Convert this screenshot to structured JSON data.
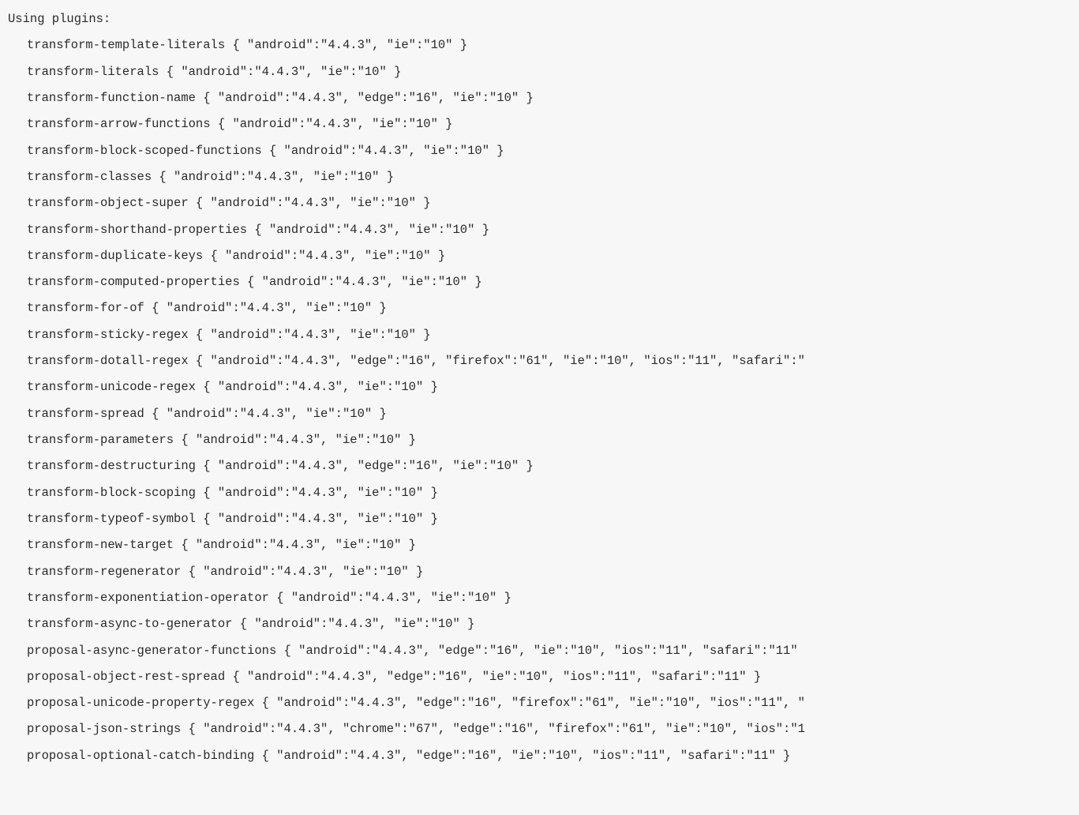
{
  "header": "Using plugins:",
  "lines": [
    "transform-template-literals { \"android\":\"4.4.3\", \"ie\":\"10\" }",
    "transform-literals { \"android\":\"4.4.3\", \"ie\":\"10\" }",
    "transform-function-name { \"android\":\"4.4.3\", \"edge\":\"16\", \"ie\":\"10\" }",
    "transform-arrow-functions { \"android\":\"4.4.3\", \"ie\":\"10\" }",
    "transform-block-scoped-functions { \"android\":\"4.4.3\", \"ie\":\"10\" }",
    "transform-classes { \"android\":\"4.4.3\", \"ie\":\"10\" }",
    "transform-object-super { \"android\":\"4.4.3\", \"ie\":\"10\" }",
    "transform-shorthand-properties { \"android\":\"4.4.3\", \"ie\":\"10\" }",
    "transform-duplicate-keys { \"android\":\"4.4.3\", \"ie\":\"10\" }",
    "transform-computed-properties { \"android\":\"4.4.3\", \"ie\":\"10\" }",
    "transform-for-of { \"android\":\"4.4.3\", \"ie\":\"10\" }",
    "transform-sticky-regex { \"android\":\"4.4.3\", \"ie\":\"10\" }",
    "transform-dotall-regex { \"android\":\"4.4.3\", \"edge\":\"16\", \"firefox\":\"61\", \"ie\":\"10\", \"ios\":\"11\", \"safari\":\"",
    "transform-unicode-regex { \"android\":\"4.4.3\", \"ie\":\"10\" }",
    "transform-spread { \"android\":\"4.4.3\", \"ie\":\"10\" }",
    "transform-parameters { \"android\":\"4.4.3\", \"ie\":\"10\" }",
    "transform-destructuring { \"android\":\"4.4.3\", \"edge\":\"16\", \"ie\":\"10\" }",
    "transform-block-scoping { \"android\":\"4.4.3\", \"ie\":\"10\" }",
    "transform-typeof-symbol { \"android\":\"4.4.3\", \"ie\":\"10\" }",
    "transform-new-target { \"android\":\"4.4.3\", \"ie\":\"10\" }",
    "transform-regenerator { \"android\":\"4.4.3\", \"ie\":\"10\" }",
    "transform-exponentiation-operator { \"android\":\"4.4.3\", \"ie\":\"10\" }",
    "transform-async-to-generator { \"android\":\"4.4.3\", \"ie\":\"10\" }",
    "proposal-async-generator-functions { \"android\":\"4.4.3\", \"edge\":\"16\", \"ie\":\"10\", \"ios\":\"11\", \"safari\":\"11\"",
    "proposal-object-rest-spread { \"android\":\"4.4.3\", \"edge\":\"16\", \"ie\":\"10\", \"ios\":\"11\", \"safari\":\"11\" }",
    "proposal-unicode-property-regex { \"android\":\"4.4.3\", \"edge\":\"16\", \"firefox\":\"61\", \"ie\":\"10\", \"ios\":\"11\", \"",
    "proposal-json-strings { \"android\":\"4.4.3\", \"chrome\":\"67\", \"edge\":\"16\", \"firefox\":\"61\", \"ie\":\"10\", \"ios\":\"1",
    "proposal-optional-catch-binding { \"android\":\"4.4.3\", \"edge\":\"16\", \"ie\":\"10\", \"ios\":\"11\", \"safari\":\"11\" }"
  ]
}
